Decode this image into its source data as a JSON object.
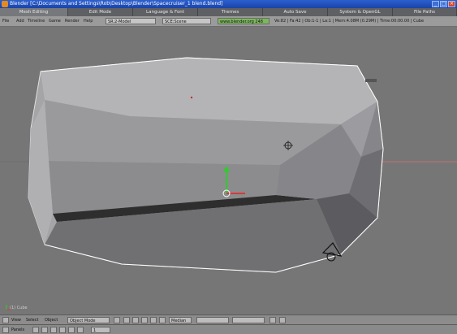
{
  "window": {
    "title": "Blender [C:\\Documents and Settings\\Rob\\Desktop\\Blender\\Spacecruiser_1 blend.blend]"
  },
  "tabs": [
    {
      "label": "Mesh Editing",
      "active": true
    },
    {
      "label": "Edit Mode",
      "active": false
    },
    {
      "label": "Language & Font",
      "active": false
    },
    {
      "label": "Themes",
      "active": false
    },
    {
      "label": "Auto Save",
      "active": false
    },
    {
      "label": "System & OpenGL",
      "active": false
    },
    {
      "label": "File Paths",
      "active": false
    }
  ],
  "header": {
    "menus": [
      "File",
      "Add",
      "Timeline",
      "Game",
      "Render",
      "Help"
    ],
    "screen": "SR:2-Model",
    "scene": "SCE:Scene",
    "engine": "www.blender.org 248",
    "stats": "Ve:82 | Fa:42 | Ob:1-1 | La:1 | Mem:4.08M (0.29M) | Time:00:00.00 | Cube"
  },
  "viewport": {
    "background_color": "#767676",
    "mesh_color": "#a5a5a8",
    "object_name": "(1) Cube",
    "has_grid_axis": true
  },
  "bottom_toolbar": {
    "view": "View",
    "select": "Select",
    "object": "Object",
    "mode": "Object Mode",
    "pivot": "Median",
    "layer_label": "1",
    "frame_label": "1"
  },
  "bottom_toolbar2": {
    "panels": "Panels",
    "frame": "1"
  }
}
